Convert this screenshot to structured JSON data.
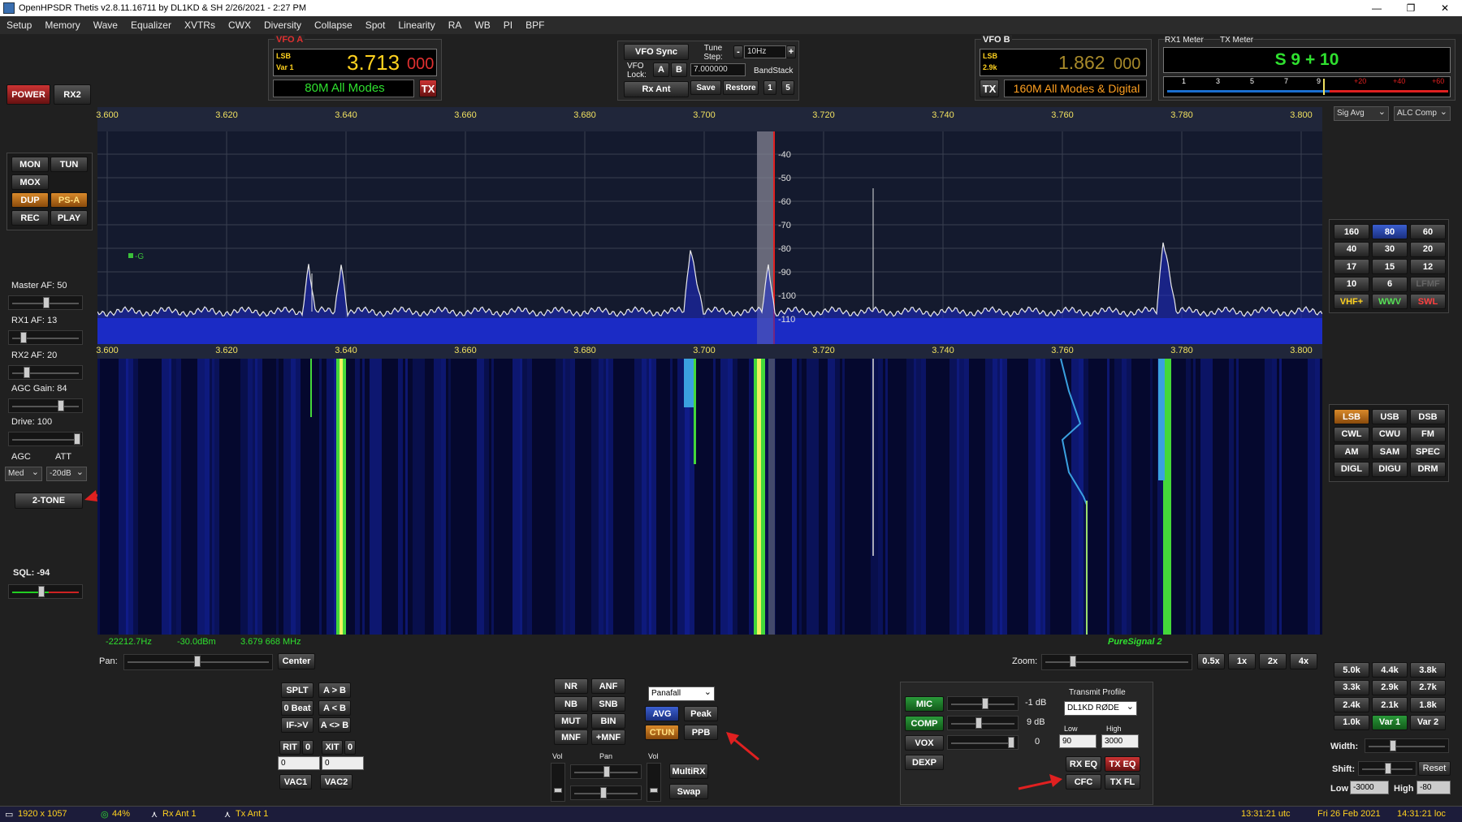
{
  "window": {
    "title": "OpenHPSDR Thetis v2.8.11.16711 by DL1KD & SH 2/26/2021 - 2:27 PM",
    "min": "—",
    "restore": "❐",
    "close": "✕"
  },
  "menu": [
    "Setup",
    "Memory",
    "Wave",
    "Equalizer",
    "XVTRs",
    "CWX",
    "Diversity",
    "Collapse",
    "Spot",
    "Linearity",
    "RA",
    "WB",
    "PI",
    "BPF"
  ],
  "left": {
    "power": "POWER",
    "rx2": "RX2",
    "mon": "MON",
    "tun": "TUN",
    "mox": "MOX",
    "dup": "DUP",
    "psa": "PS-A",
    "rec": "REC",
    "play": "PLAY",
    "master_af": "Master AF:  50",
    "rx1_af": "RX1 AF:  13",
    "rx2_af": "RX2 AF:  20",
    "agc_gain": "AGC Gain:  84",
    "drive": "Drive:  100",
    "agc_label": "AGC",
    "att_label": "ATT",
    "agc_value": "Med",
    "att_value": "-20dB",
    "two_tone": "2-TONE",
    "sql": "SQL:  -94"
  },
  "vfoa": {
    "title": "VFO A",
    "mode": "LSB",
    "var": "Var 1",
    "freq_main": "3.713",
    "freq_sub": "000",
    "band": "80M All Modes",
    "tx": "TX"
  },
  "vfo_sync": {
    "sync": "VFO Sync",
    "tune_step_label": "Tune Step:",
    "minus": "-",
    "step": "10Hz",
    "plus": "+",
    "lock_label": "VFO Lock:",
    "a": "A",
    "b": "B",
    "lock_freq": "7.000000",
    "bandstack": "BandStack",
    "rx_ant": "Rx Ant",
    "save": "Save",
    "restore": "Restore",
    "n1": "1",
    "n5": "5"
  },
  "vfob": {
    "title": "VFO B",
    "mode": "LSB",
    "var": "2.9k",
    "freq_main": "1.862",
    "freq_sub": "000",
    "tx": "TX",
    "band": "160M All Modes & Digital"
  },
  "meter": {
    "rx1": "RX1 Meter",
    "tx": "TX Meter",
    "reading": "S 9 + 10",
    "scale": [
      "1",
      "3",
      "5",
      "7",
      "9",
      "+20",
      "+40",
      "+60"
    ],
    "sig_avg": "Sig Avg",
    "alc_comp": "ALC Comp"
  },
  "spectrum": {
    "freq_ticks": [
      "3.600",
      "3.620",
      "3.640",
      "3.660",
      "3.680",
      "3.700",
      "3.720",
      "3.740",
      "3.760",
      "3.780",
      "3.800"
    ],
    "db_ticks": [
      "-40",
      "-50",
      "-60",
      "-70",
      "-80",
      "-90",
      "-100",
      "-110"
    ],
    "marker": "-G",
    "readout_hz": "-22212.7Hz",
    "readout_dbm": "-30.0dBm",
    "readout_mhz": "3.679 668 MHz",
    "puresignal": "PureSignal 2"
  },
  "bands": [
    "160",
    "80",
    "60",
    "40",
    "30",
    "20",
    "17",
    "15",
    "12",
    "10",
    "6",
    "LFMF",
    "VHF+",
    "WWV",
    "SWL"
  ],
  "modes": [
    "LSB",
    "USB",
    "DSB",
    "CWL",
    "CWU",
    "FM",
    "AM",
    "SAM",
    "SPEC",
    "DIGL",
    "DIGU",
    "DRM"
  ],
  "pan": {
    "label": "Pan:",
    "center": "Center",
    "zoom_label": "Zoom:",
    "zooms": [
      "0.5x",
      "1x",
      "2x",
      "4x"
    ]
  },
  "split": {
    "splt": "SPLT",
    "atob": "A > B",
    "zero_beat": "0 Beat",
    "btoa": "A < B",
    "if_v": "IF->V",
    "swap_ab": "A <> B",
    "rit": "RIT",
    "rit_val": "0",
    "xit": "XIT",
    "xit_val": "0",
    "rit_field": "0",
    "xit_field": "0",
    "vac1": "VAC1",
    "vac2": "VAC2"
  },
  "dsp": {
    "nr": "NR",
    "anf": "ANF",
    "nb": "NB",
    "snb": "SNB",
    "mut": "MUT",
    "bin": "BIN",
    "mnf": "MNF",
    "pmnf": "+MNF",
    "display_mode": "Panafall",
    "avg": "AVG",
    "peak": "Peak",
    "ctun": "CTUN",
    "ppb": "PPB",
    "vol": "Vol",
    "pan": "Pan",
    "vol2": "Vol",
    "multirx": "MultiRX",
    "swap": "Swap"
  },
  "tx": {
    "mic": "MIC",
    "mic_val": "-1 dB",
    "comp": "COMP",
    "comp_val": "9 dB",
    "vox": "VOX",
    "vox_val": "0",
    "dexp": "DEXP",
    "profile_label": "Transmit Profile",
    "profile": "DL1KD RØDE",
    "low_label": "Low",
    "high_label": "High",
    "low": "90",
    "high": "3000",
    "rx_eq": "RX EQ",
    "tx_eq": "TX EQ",
    "cfc": "CFC",
    "tx_fl": "TX FL"
  },
  "filters": {
    "list": [
      "5.0k",
      "4.4k",
      "3.8k",
      "3.3k",
      "2.9k",
      "2.7k",
      "2.4k",
      "2.1k",
      "1.8k",
      "1.0k",
      "Var 1",
      "Var 2"
    ],
    "width": "Width:",
    "shift": "Shift:",
    "reset": "Reset",
    "low_label": "Low",
    "low": "-3000",
    "high_label": "High",
    "high": "-80"
  },
  "status": {
    "resolution": "1920 x 1057",
    "cpu": "44%",
    "rx_ant": "Rx Ant 1",
    "tx_ant": "Tx Ant 1",
    "utc": "13:31:21 utc",
    "date": "Fri 26 Feb 2021",
    "local": "14:31:21 loc"
  }
}
